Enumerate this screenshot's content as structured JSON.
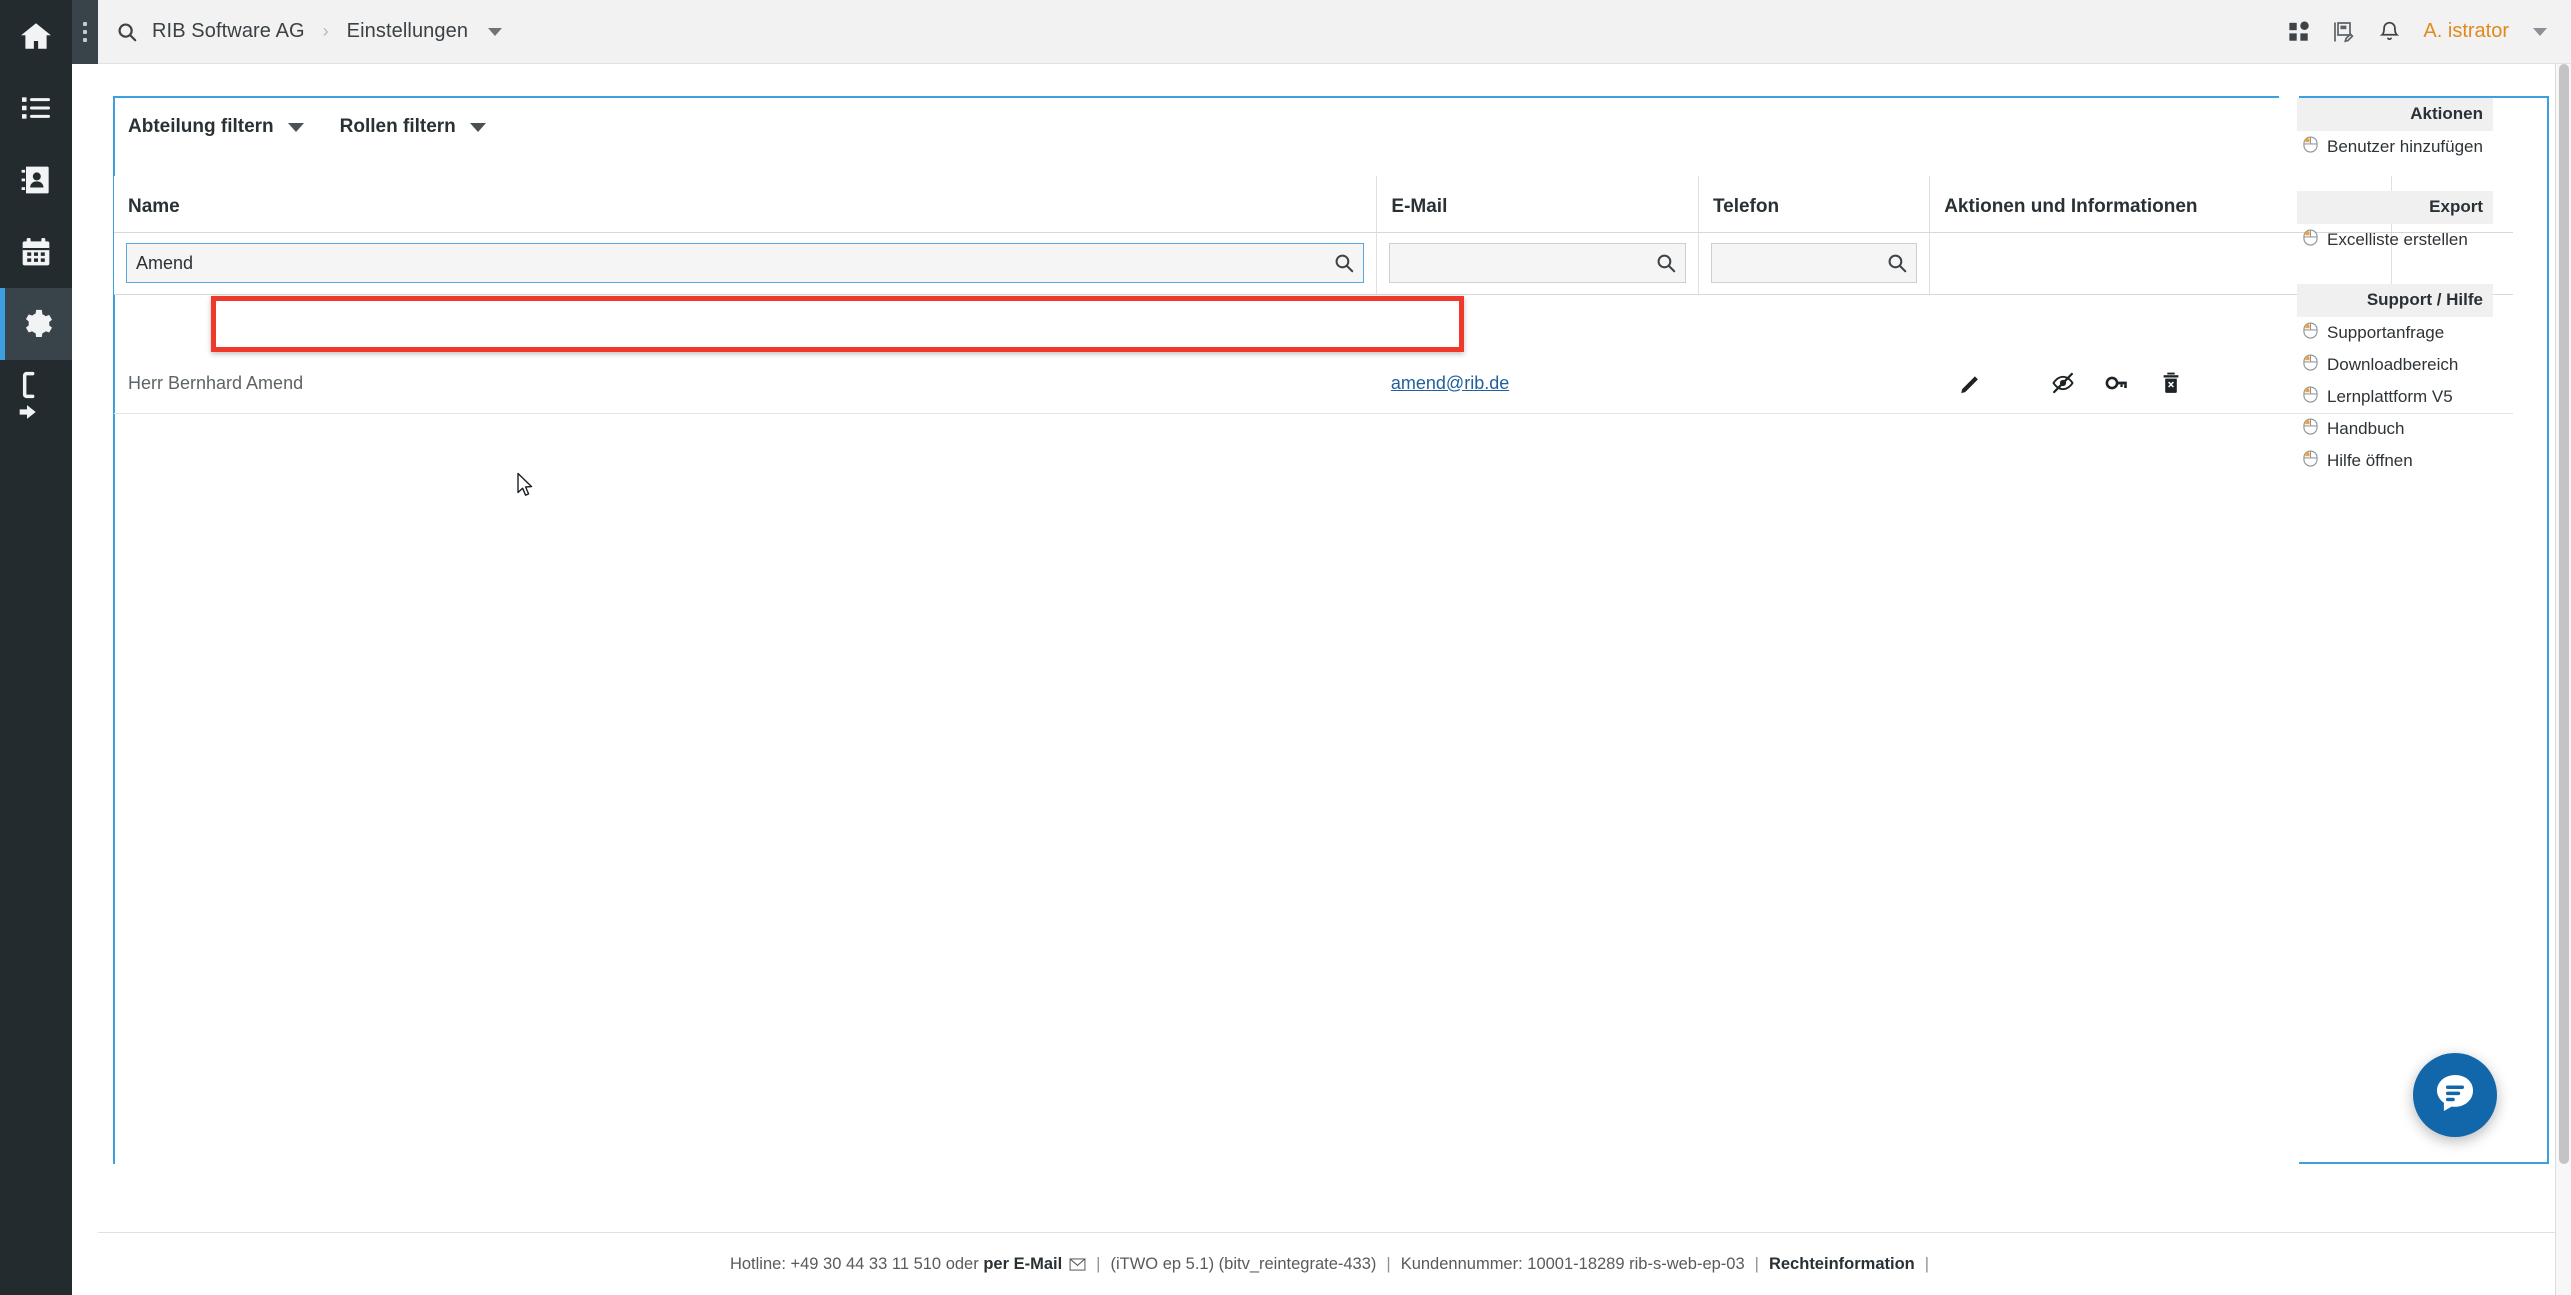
{
  "topbar": {
    "search_icon": "search-icon",
    "breadcrumb": {
      "root": "RIB Software AG",
      "separator": "›",
      "current": "Einstellungen"
    },
    "apps_icon": "apps-grid-icon",
    "notes_icon": "note-edit-icon",
    "bell_icon": "bell-icon",
    "user": "A. istrator"
  },
  "rail": {
    "items": [
      {
        "name": "home",
        "icon": "home-icon"
      },
      {
        "name": "tasks",
        "icon": "list-icon"
      },
      {
        "name": "contacts",
        "icon": "address-book-icon"
      },
      {
        "name": "calendar",
        "icon": "calendar-icon"
      },
      {
        "name": "settings",
        "icon": "gear-icon",
        "active": true
      },
      {
        "name": "logout",
        "icon": "logout-icon"
      }
    ],
    "kebab": "more-options-icon"
  },
  "filters": [
    {
      "label": "Abteilung filtern",
      "icon": "chevron-down-icon"
    },
    {
      "label": "Rollen filtern",
      "icon": "chevron-down-icon"
    }
  ],
  "table": {
    "columns": [
      "Name",
      "E-Mail",
      "Telefon",
      "Aktionen und Informationen",
      ""
    ],
    "search_row": {
      "name_value": "Amend",
      "name_placeholder": "",
      "mail_value": "",
      "mail_placeholder": "",
      "tel_value": "",
      "tel_placeholder": "",
      "search_icon": "search-icon"
    },
    "rows": [
      {
        "name": "Herr Bernhard Amend",
        "email": "amend@rib.de",
        "telefon": "",
        "actions": [
          {
            "name": "edit-user-button",
            "icon": "pencil-icon"
          },
          {
            "name": "hide-user-button",
            "icon": "eye-slash-icon"
          },
          {
            "name": "reset-password-button",
            "icon": "key-icon"
          },
          {
            "name": "delete-user-button",
            "icon": "trash-x-icon"
          }
        ]
      }
    ]
  },
  "sidebar_panel": {
    "groups": [
      {
        "title": "Aktionen",
        "items": [
          {
            "label": "Benutzer hinzufügen",
            "icon": "mouse-click-icon"
          }
        ]
      },
      {
        "title": "Export",
        "items": [
          {
            "label": "Excelliste erstellen",
            "icon": "mouse-click-icon"
          }
        ]
      },
      {
        "title": "Support / Hilfe",
        "items": [
          {
            "label": "Supportanfrage",
            "icon": "mouse-click-icon"
          },
          {
            "label": "Downloadbereich",
            "icon": "mouse-click-icon"
          },
          {
            "label": "Lernplattform V5",
            "icon": "mouse-click-icon"
          },
          {
            "label": "Handbuch",
            "icon": "mouse-click-icon"
          },
          {
            "label": "Hilfe öffnen",
            "icon": "mouse-click-icon"
          }
        ]
      }
    ]
  },
  "fab": {
    "icon": "chat-bubble-icon",
    "color": "#1267ab"
  },
  "footer": {
    "hotline": "Hotline: +49 30 44 33 11 510 oder",
    "mail_link": "per E-Mail",
    "mail_icon": "envelope-icon",
    "sep": "|",
    "version": "(iTWO ep 5.1) (bitv_reintegrate-433)",
    "customer": "Kundennummer: 10001-18289 rib-s-web-ep-03",
    "legal": "Rechteinformation"
  },
  "colors": {
    "accent_blue": "#3c9fe0",
    "brand_orange": "#e08a1e",
    "highlight_red": "#f0392b",
    "rail_dark": "#242b2e"
  }
}
